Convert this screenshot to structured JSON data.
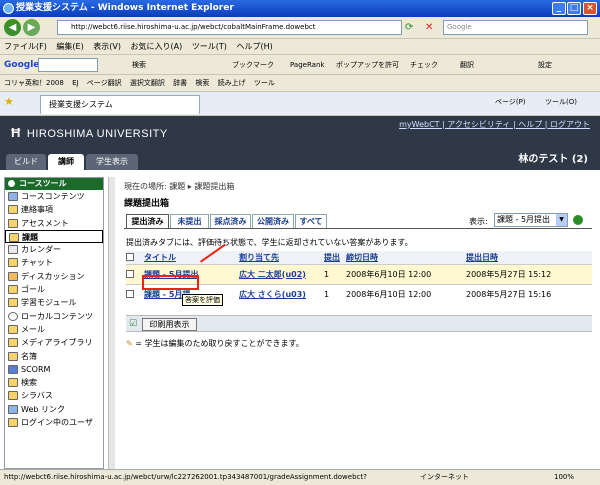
{
  "window": {
    "title": "授業支援システム - Windows Internet Explorer"
  },
  "address": {
    "url": "http://webct6.riise.hiroshima-u.ac.jp/webct/cobaltMainFrame.dowebct",
    "search_placeholder": "Google"
  },
  "menubar": [
    "ファイル(F)",
    "編集(E)",
    "表示(V)",
    "お気に入り(A)",
    "ツール(T)",
    "ヘルプ(H)"
  ],
  "googlebar": {
    "label": "Google",
    "items": [
      "検索",
      "ブックマーク",
      "PageRank",
      "ポップアップを許可",
      "チェック",
      "翻訳",
      "設定"
    ]
  },
  "linksbar": [
    "コリャ英和！2008",
    "EJ",
    "ページ翻訳",
    "選択文翻訳",
    "辞書",
    "検索",
    "読み上げ",
    "ツール"
  ],
  "tab": {
    "title": "授業支援システム",
    "page": "ページ(P)",
    "tools": "ツール(O)"
  },
  "header": {
    "university": "HIROSHIMA UNIVERSITY",
    "links": "myWebCT | アクセシビリティ | ヘルプ | ログアウト",
    "course": "林のテスト (2)"
  },
  "roles": [
    "ビルド",
    "講師",
    "学生表示"
  ],
  "sidebar": {
    "title": "コースツール",
    "items": [
      "コースコンテンツ",
      "連絡事項",
      "アセスメント",
      "課題",
      "カレンダー",
      "チャット",
      "ディスカッション",
      "ゴール",
      "学習モジュール",
      "ローカルコンテンツ",
      "メール",
      "メディアライブラリ",
      "名簿",
      "SCORM",
      "検索",
      "シラバス",
      "Web リンク",
      "ログイン中のユーザ"
    ]
  },
  "main": {
    "breadcrumb": "現在の場所: 課題 ▸ 課題提出箱",
    "title": "課題提出箱",
    "tabs": [
      "提出済み",
      "未提出",
      "採点済み",
      "公開済み",
      "すべて"
    ],
    "show_label": "表示:",
    "show_value": "課題 - 5月提出",
    "notice": "提出済みタブには、評価待ち状態で、学生に返却されていない答案があります。",
    "columns": [
      "タイトル",
      "割り当て先",
      "提出",
      "締切日時",
      "提出日時"
    ],
    "rows": [
      {
        "title": "課題 - 5月提出",
        "assignee": "広大 二太郎(u02)",
        "count": "1",
        "due": "2008年6月10日 12:00",
        "submitted": "2008年5月27日 15:12"
      },
      {
        "title": "課題 - 5月提",
        "assignee": "広大 さくら(u03)",
        "count": "1",
        "due": "2008年6月10日 12:00",
        "submitted": "2008年5月27日 15:16"
      }
    ],
    "tooltip": "答案を評価",
    "grade_button": "印刷用表示",
    "note": "= 学生は編集のため取り戻すことができます。"
  },
  "status": {
    "url": "http://webct6.riise.hiroshima-u.ac.jp/webct/urw/lc227262001.tp343487001/gradeAssignment.dowebct?",
    "zone": "インターネット",
    "zoom": "100%"
  }
}
